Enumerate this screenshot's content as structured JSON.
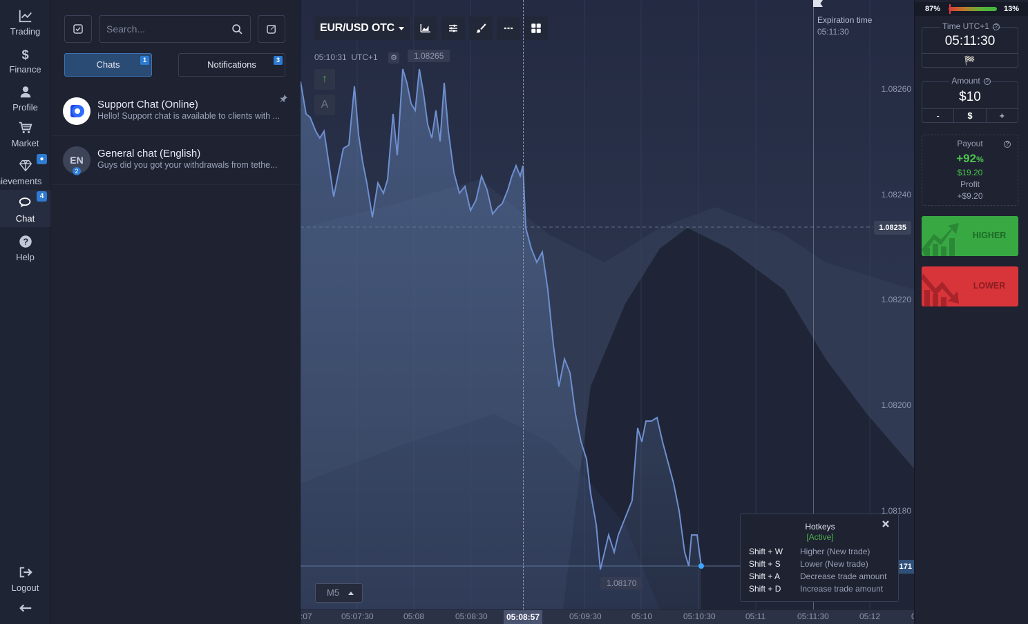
{
  "nav": {
    "items": [
      {
        "label": "Trading",
        "icon": "chart-line-icon"
      },
      {
        "label": "Finance",
        "icon": "dollar-icon"
      },
      {
        "label": "Profile",
        "icon": "user-icon"
      },
      {
        "label": "Market",
        "icon": "cart-icon"
      },
      {
        "label": "Achievements",
        "icon": "diamond-icon"
      },
      {
        "label": "Chat",
        "icon": "chat-icon",
        "badge": "4"
      },
      {
        "label": "Help",
        "icon": "help-icon"
      }
    ],
    "logout_label": "Logout",
    "collapse_icon": "arrow-left-icon"
  },
  "chat": {
    "search_placeholder": "Search...",
    "tabs": [
      {
        "label": "Chats",
        "badge": "1"
      },
      {
        "label": "Notifications",
        "badge": "3"
      }
    ],
    "items": [
      {
        "title": "Support Chat (Online)",
        "message": "Hello! Support chat is available to clients with ...",
        "avatar": "support-logo"
      },
      {
        "title": "General chat (English)",
        "message": "Guys did you got your withdrawals from tethe...",
        "avatar_text": "EN",
        "avatar_badge": "2"
      }
    ]
  },
  "chart": {
    "pair": "EUR/USD OTC",
    "clock": "05:10:31",
    "tz": "UTC+1",
    "hi_value": "1.08265",
    "lo_value": "1.08170",
    "current_price": "1.08235",
    "right_tag": "171",
    "expiration_label": "Expiration time",
    "expiration_time": "05:11:30",
    "now_time": "05:08:57",
    "timeframe": "M5",
    "tool_up": "↑",
    "tool_a": "A",
    "price_labels": [
      "1.08260",
      "1.08240",
      "1.08220",
      "1.08200",
      "1.08180"
    ],
    "time_labels": [
      ":07",
      "05:07:30",
      "05:08",
      "05:08:30",
      "05:09:30",
      "05:10",
      "05:10:30",
      "05:11",
      "05:11:30",
      "05:12",
      "0"
    ]
  },
  "hotkeys": {
    "title": "Hotkeys",
    "status": "[Active]",
    "rows": [
      {
        "key": "Shift + W",
        "desc": "Higher (New trade)"
      },
      {
        "key": "Shift + S",
        "desc": "Lower (New trade)"
      },
      {
        "key": "Shift + A",
        "desc": "Decrease trade amount"
      },
      {
        "key": "Shift + D",
        "desc": "Increase trade amount"
      }
    ]
  },
  "trade": {
    "sentiment_left": "87%",
    "sentiment_right": "13%",
    "time_label": "Time UTC+1",
    "time_value": "05:11:30",
    "amount_label": "Amount",
    "amount_value": "$10",
    "amount_minus": "-",
    "amount_currency": "$",
    "amount_plus": "+",
    "payout_label": "Payout",
    "payout_pct": "+92",
    "payout_pct_sign": "%",
    "payout_amount": "$19.20",
    "profit_label": "Profit",
    "profit_value": "+$9.20",
    "higher_label": "HIGHER",
    "lower_label": "LOWER",
    "colors": {
      "higher": "#38a843",
      "lower": "#d8353a",
      "accent": "#2d7bd2"
    }
  }
}
